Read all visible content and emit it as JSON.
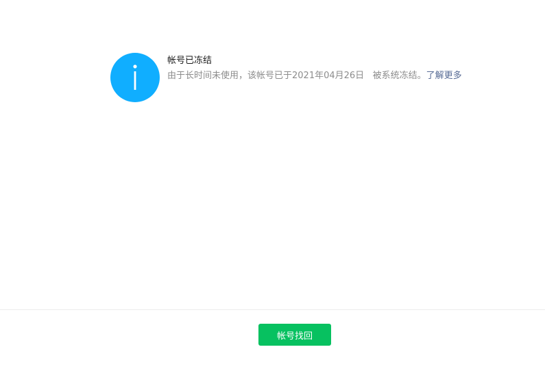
{
  "notice": {
    "icon": "info-icon",
    "icon_color": "#10aeff",
    "title": "帐号已冻结",
    "description": "由于长时间未使用，该帐号已于2021年04月26日   被系统冻结。",
    "link_label": "了解更多",
    "link_color": "#576b95"
  },
  "footer": {
    "recover_button_label": "帐号找回",
    "button_color": "#07c160"
  }
}
